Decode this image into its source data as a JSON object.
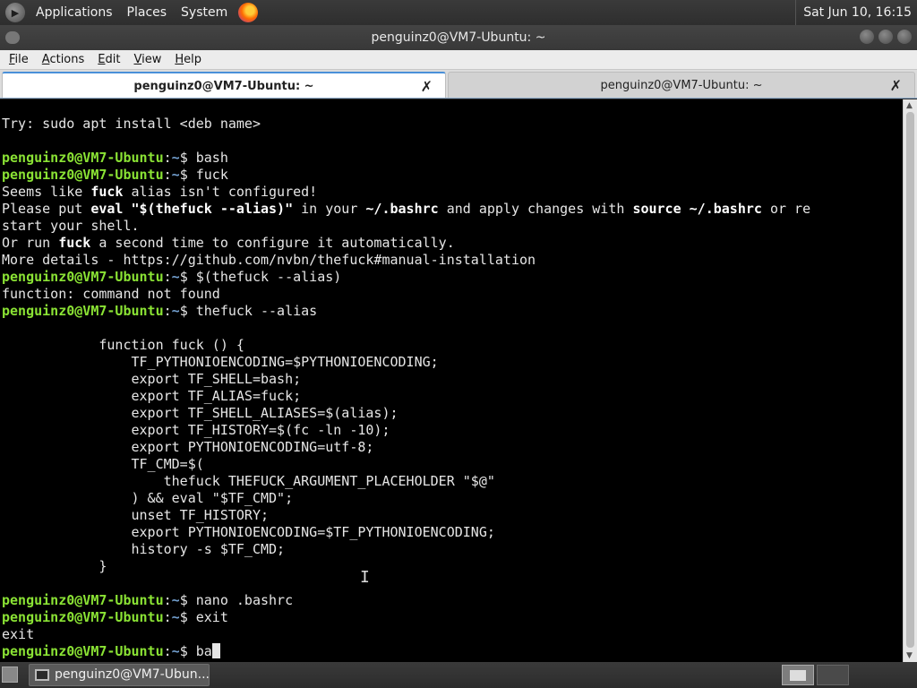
{
  "top_panel": {
    "menus": [
      "Applications",
      "Places",
      "System"
    ],
    "clock": "Sat Jun 10, 16:15"
  },
  "window": {
    "title": "penguinz0@VM7-Ubuntu: ~"
  },
  "menubar": {
    "items": [
      {
        "acc": "F",
        "rest": "ile"
      },
      {
        "acc": "A",
        "rest": "ctions"
      },
      {
        "acc": "E",
        "rest": "dit"
      },
      {
        "acc": "V",
        "rest": "iew"
      },
      {
        "acc": "H",
        "rest": "elp"
      }
    ]
  },
  "tabs": [
    {
      "label": "penguinz0@VM7-Ubuntu: ~",
      "active": true,
      "close": "✗"
    },
    {
      "label": "penguinz0@VM7-Ubuntu: ~",
      "active": false,
      "close": "✗"
    }
  ],
  "terminal": {
    "user": "penguinz0@VM7-Ubuntu",
    "sep": ":",
    "path": "~",
    "prompt_end": "$ ",
    "lines": [
      {
        "t": "Try: sudo apt install <deb name>"
      },
      {
        "t": ""
      },
      {
        "p": true,
        "t": "bash"
      },
      {
        "p": true,
        "t": "fuck"
      },
      {
        "seg": [
          [
            "Seems like ",
            0
          ],
          [
            "fuck",
            1
          ],
          [
            " alias isn't configured!",
            0
          ]
        ]
      },
      {
        "seg": [
          [
            "Please put ",
            0
          ],
          [
            "eval \"$(thefuck --alias)\"",
            1
          ],
          [
            " in your ",
            0
          ],
          [
            "~/.bashrc",
            1
          ],
          [
            " and apply changes with ",
            0
          ],
          [
            "source ~/.bashrc",
            1
          ],
          [
            " or re",
            0
          ]
        ]
      },
      {
        "t": "start your shell."
      },
      {
        "seg": [
          [
            "Or run ",
            0
          ],
          [
            "fuck",
            1
          ],
          [
            " a second time to configure it automatically.",
            0
          ]
        ]
      },
      {
        "t": "More details - https://github.com/nvbn/thefuck#manual-installation"
      },
      {
        "p": true,
        "t": "$(thefuck --alias)"
      },
      {
        "t": "function: command not found"
      },
      {
        "p": true,
        "t": "thefuck --alias"
      },
      {
        "t": ""
      },
      {
        "t": "            function fuck () {"
      },
      {
        "t": "                TF_PYTHONIOENCODING=$PYTHONIOENCODING;"
      },
      {
        "t": "                export TF_SHELL=bash;"
      },
      {
        "t": "                export TF_ALIAS=fuck;"
      },
      {
        "t": "                export TF_SHELL_ALIASES=$(alias);"
      },
      {
        "t": "                export TF_HISTORY=$(fc -ln -10);"
      },
      {
        "t": "                export PYTHONIOENCODING=utf-8;"
      },
      {
        "t": "                TF_CMD=$("
      },
      {
        "t": "                    thefuck THEFUCK_ARGUMENT_PLACEHOLDER \"$@\""
      },
      {
        "t": "                ) && eval \"$TF_CMD\";"
      },
      {
        "t": "                unset TF_HISTORY;"
      },
      {
        "t": "                export PYTHONIOENCODING=$TF_PYTHONIOENCODING;"
      },
      {
        "t": "                history -s $TF_CMD;"
      },
      {
        "t": "            }"
      },
      {
        "t": ""
      },
      {
        "p": true,
        "t": "nano .bashrc"
      },
      {
        "p": true,
        "t": "exit"
      },
      {
        "t": "exit"
      },
      {
        "p": true,
        "t": "ba",
        "cursor": true
      }
    ]
  },
  "taskbar": {
    "window_label": "penguinz0@VM7-Ubun..."
  }
}
